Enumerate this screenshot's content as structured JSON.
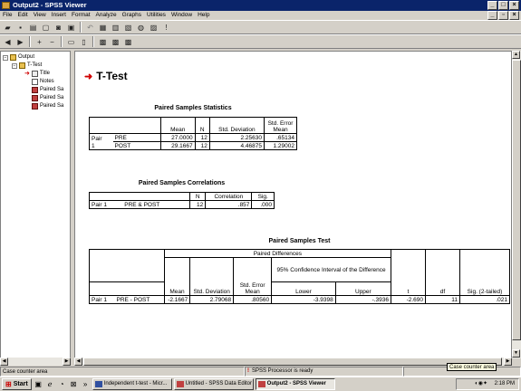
{
  "window": {
    "title": "Output2 - SPSS Viewer"
  },
  "menu": [
    "File",
    "Edit",
    "View",
    "Insert",
    "Format",
    "Analyze",
    "Graphs",
    "Utilities",
    "Window",
    "Help"
  ],
  "tree": {
    "root": "Output",
    "ttest": "T-Test",
    "items": [
      "Title",
      "Notes",
      "Paired Sa",
      "Paired Sa",
      "Paired Sa"
    ]
  },
  "section_title": "T-Test",
  "stats": {
    "title": "Paired Samples Statistics",
    "headers": [
      "Mean",
      "N",
      "Std. Deviation",
      "Std. Error Mean"
    ],
    "pair_label_1": "Pair",
    "pair_label_2": "1",
    "rows": [
      {
        "label": "PRE",
        "mean": "27.0000",
        "n": "12",
        "sd": "2.25630",
        "se": ".65134"
      },
      {
        "label": "POST",
        "mean": "29.1667",
        "n": "12",
        "sd": "4.46875",
        "se": "1.29002"
      }
    ]
  },
  "corr": {
    "title": "Paired Samples Correlations",
    "headers": [
      "N",
      "Correlation",
      "Sig."
    ],
    "row": {
      "pair": "Pair 1",
      "label": "PRE & POST",
      "n": "12",
      "corr": ".857",
      "sig": ".000"
    }
  },
  "test": {
    "title": "Paired Samples Test",
    "paired_diff": "Paired Differences",
    "ci": "95% Confidence Interval of the Difference",
    "headers": {
      "mean": "Mean",
      "sd": "Std. Deviation",
      "se": "Std. Error Mean",
      "lower": "Lower",
      "upper": "Upper",
      "t": "t",
      "df": "df",
      "sig": "Sig. (2-tailed)"
    },
    "row": {
      "pair": "Pair 1",
      "label": "PRE - POST",
      "mean": "-2.1667",
      "sd": "2.79068",
      "se": ".80560",
      "lower": "-3.9398",
      "upper": "-.3936",
      "t": "-2.690",
      "df": "11",
      "sig": ".021"
    }
  },
  "status": {
    "left": "Case counter area",
    "processor": "SPSS Processor  is ready",
    "tooltip": "Case counter area"
  },
  "taskbar": {
    "start": "Start",
    "tasks": [
      "Independent t-test - Micr...",
      "Untitled - SPSS Data Editor",
      "Output2 - SPSS Viewer"
    ],
    "clock": "2:18 PM"
  }
}
